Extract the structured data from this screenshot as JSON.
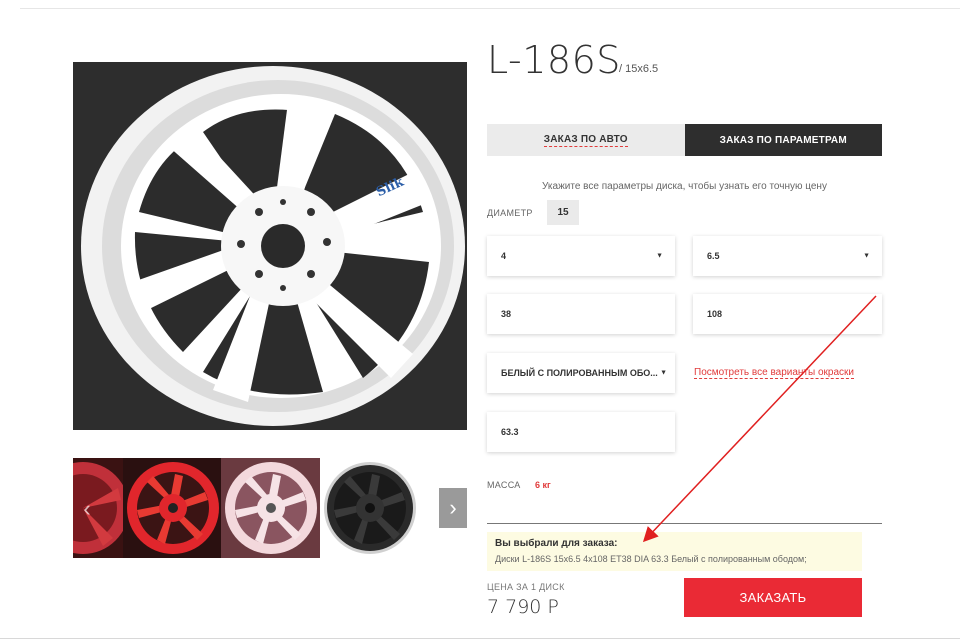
{
  "product": {
    "title": "L-186S",
    "subtitle": "/ 15x6.5",
    "brand_mark": "Slik"
  },
  "gallery": {
    "prev_icon": "‹",
    "next_icon": "›",
    "thumbnails": [
      {
        "color_name": "red-partial",
        "rim": "#c0303a",
        "spoke": "#d23a3f"
      },
      {
        "color_name": "red",
        "rim": "#e1262c",
        "spoke": "#e83a32"
      },
      {
        "color_name": "white-pink",
        "rim": "#f3d8dc",
        "spoke": "#f6e3e6"
      },
      {
        "color_name": "black",
        "rim": "#2a2a2a",
        "spoke": "#3a3a3a"
      }
    ]
  },
  "tabs": {
    "auto_label": "ЗАКАЗ ПО АВТО",
    "params_label": "ЗАКАЗ ПО ПАРАМЕТРАМ"
  },
  "form": {
    "hint": "Укажите все параметры диска, чтобы узнать его точную цену",
    "diameter_label": "ДИАМЕТР",
    "diameter_value": "15",
    "pcd_count": "4",
    "width": "6.5",
    "et": "38",
    "pcd": "108",
    "color": "БЕЛЫЙ С ПОЛИРОВАННЫМ ОБО...",
    "all_colors_link": "Посмотреть все варианты окраски",
    "dia": "63.3",
    "caret": "▼"
  },
  "mass": {
    "label": "МАССА",
    "value": "6 кг"
  },
  "selection": {
    "title": "Вы выбрали для заказа:",
    "text": "Диски L-186S 15x6.5 4x108 ET38 DIA 63.3 Белый с полированным ободом;"
  },
  "price": {
    "label": "ЦЕНА ЗА 1 ДИСК",
    "value": "7 790 Р"
  },
  "order_button": "ЗАКАЗАТЬ",
  "colors": {
    "accent": "#ea2a35",
    "dark_tab": "#2e2e2e",
    "annotation_arrow": "#e02020"
  }
}
